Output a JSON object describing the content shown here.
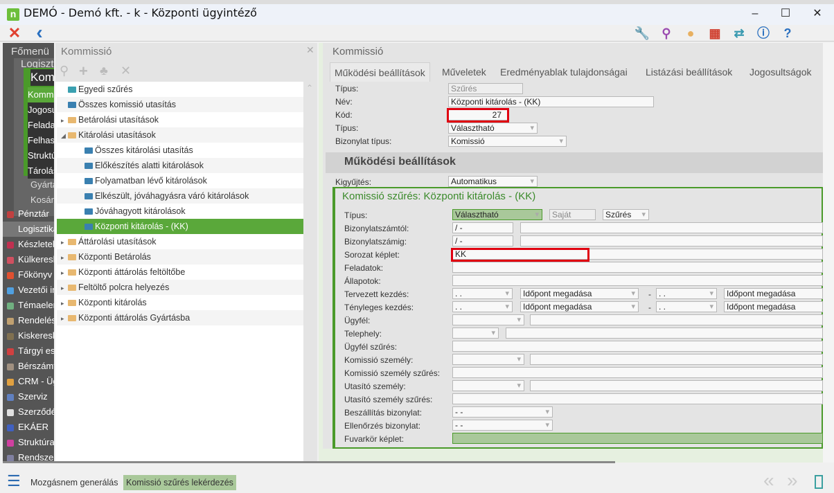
{
  "window": {
    "title": "DEMÓ - Demó kft. - k - Központi ügyintéző",
    "logo": "n",
    "minimize": "–",
    "maximize": "☐",
    "close": "✕"
  },
  "toolbar": {
    "close_icon": "✕",
    "back_icon": "‹",
    "right_icons": [
      {
        "name": "wrench-icon",
        "glyph": "🔧",
        "color": "#4aaa7a"
      },
      {
        "name": "search-icon",
        "glyph": "⚲",
        "color": "#9a4ab0"
      },
      {
        "name": "user-icon",
        "glyph": "●",
        "color": "#e8b060"
      },
      {
        "name": "modules-icon",
        "glyph": "▦",
        "color": "#d04030"
      },
      {
        "name": "swap-icon",
        "glyph": "⇄",
        "color": "#3a9ab0"
      },
      {
        "name": "info-icon",
        "glyph": "ⓘ",
        "color": "#2a70c0"
      },
      {
        "name": "help-icon",
        "glyph": "?",
        "color": "#2a70c0"
      }
    ]
  },
  "leftmenu": {
    "header": "Főmenü",
    "sub": "Logisztika",
    "active_group": "Kommissió",
    "group_items": [
      "Kommissió",
      "Jogosultságok",
      "Feladatok",
      "Felhasználók",
      "Struktúra",
      "Tárolás"
    ],
    "sub_items": [
      "Gyártás",
      "Kosár"
    ],
    "items": [
      {
        "label": "Pénztár",
        "color": "#c04040"
      },
      {
        "label": "Logisztika",
        "color": ""
      },
      {
        "label": "Készletek",
        "color": "#c03050"
      },
      {
        "label": "Külkereskedelem",
        "color": "#d05060"
      },
      {
        "label": "Főkönyv",
        "color": "#e05030"
      },
      {
        "label": "Vezetői info",
        "color": "#50a0e0"
      },
      {
        "label": "Témaelemzés",
        "color": "#70b080"
      },
      {
        "label": "Rendelések",
        "color": "#c0a070"
      },
      {
        "label": "Kiskereskedelem",
        "color": "#807050"
      },
      {
        "label": "Tárgyi eszköz",
        "color": "#d04040"
      },
      {
        "label": "Bérszámfejtés",
        "color": "#a09080"
      },
      {
        "label": "CRM - Ügyfél",
        "color": "#e0a040"
      },
      {
        "label": "Szerviz",
        "color": "#6080c0"
      },
      {
        "label": "Szerződések",
        "color": "#e0e0e0"
      },
      {
        "label": "EKÁER",
        "color": "#4060c0"
      },
      {
        "label": "Struktúra",
        "color": "#d040a0"
      },
      {
        "label": "Rendszer",
        "color": "#8080a0"
      }
    ]
  },
  "tree": {
    "title": "Kommissió",
    "items": [
      {
        "label": "Egyedi szűrés",
        "level": 0,
        "icon": "filter",
        "exp": ""
      },
      {
        "label": "Összes komissió utasítás",
        "level": 0,
        "icon": "printer",
        "exp": ""
      },
      {
        "label": "Betárolási utasítások",
        "level": 0,
        "icon": "folder",
        "exp": "▸"
      },
      {
        "label": "Kitárolási utasítások",
        "level": 0,
        "icon": "folder",
        "exp": "◢"
      },
      {
        "label": "Összes kitárolási utasítás",
        "level": 1,
        "icon": "screen",
        "exp": ""
      },
      {
        "label": "Előkészítés alatti kitárolások",
        "level": 1,
        "icon": "screen",
        "exp": ""
      },
      {
        "label": "Folyamatban lévő kitárolások",
        "level": 1,
        "icon": "screen",
        "exp": ""
      },
      {
        "label": "Elkészült, jóváhagyásra váró kitárolások",
        "level": 1,
        "icon": "screen",
        "exp": ""
      },
      {
        "label": "Jóváhagyott kitárolások",
        "level": 1,
        "icon": "screen",
        "exp": ""
      },
      {
        "label": "Központi kitárolás - (KK)",
        "level": 1,
        "icon": "printer",
        "exp": "",
        "selected": true
      },
      {
        "label": "Áttárolási utasítások",
        "level": 0,
        "icon": "folder",
        "exp": "▸"
      },
      {
        "label": "Központi Betárolás",
        "level": 0,
        "icon": "folder",
        "exp": "▸"
      },
      {
        "label": "Központi áttárolás feltöltőbe",
        "level": 0,
        "icon": "folder",
        "exp": "▸"
      },
      {
        "label": "Feltöltő polcra helyezés",
        "level": 0,
        "icon": "folder",
        "exp": "▸"
      },
      {
        "label": "Központi kitárolás",
        "level": 0,
        "icon": "folder",
        "exp": "▸"
      },
      {
        "label": "Központi áttárolás Gyártásba",
        "level": 0,
        "icon": "folder",
        "exp": "▸"
      }
    ]
  },
  "main": {
    "title": "Kommissió",
    "tabs": [
      "Működési beállítások",
      "Műveletek",
      "Eredményablak tulajdonságai",
      "Listázási beállítások",
      "Jogosultságok"
    ],
    "top_fields": [
      {
        "label": "Típus:",
        "value": "Szűrés"
      },
      {
        "label": "Név:",
        "value": "Központi kitárolás - (KK)"
      },
      {
        "label": "Kód:",
        "value": "27"
      },
      {
        "label": "Típus:",
        "value": "Választható"
      },
      {
        "label": "Bizonylat típus:",
        "value": "Komissió"
      }
    ],
    "section_title": "Működési beállítások",
    "kigyujtes": {
      "label": "Kigyűjtés:",
      "value": "Automatikus"
    },
    "filter_box": {
      "title": "Komissió szűrés: Központi kitárolás - (KK)",
      "rows": [
        {
          "label": "Típus:",
          "values": [
            "Választható",
            "Saját",
            "Szűrés"
          ]
        },
        {
          "label": "Bizonylatszámtól:",
          "values": [
            "/ -",
            ""
          ]
        },
        {
          "label": "Bizonylatszámig:",
          "values": [
            "/ -",
            ""
          ]
        },
        {
          "label": "Sorozat képlet:",
          "values": [
            "KK"
          ]
        },
        {
          "label": "Feladatok:",
          "values": [
            ""
          ]
        },
        {
          "label": "Állapotok:",
          "values": [
            ""
          ]
        },
        {
          "label": "Tervezett kezdés:",
          "values": [
            ". .",
            "Időpont megadása",
            "-",
            ". .",
            "Időpont megadása"
          ]
        },
        {
          "label": "Tényleges kezdés:",
          "values": [
            ". .",
            "Időpont megadása",
            "-",
            ". .",
            "Időpont megadása"
          ]
        },
        {
          "label": "Ügyfél:",
          "values": [
            "",
            ""
          ]
        },
        {
          "label": "Telephely:",
          "values": [
            "",
            ""
          ]
        },
        {
          "label": "Ügyfél szűrés:",
          "values": [
            ""
          ]
        },
        {
          "label": "Komissió személy:",
          "values": [
            "",
            ""
          ]
        },
        {
          "label": "Komissió személy szűrés:",
          "values": [
            ""
          ]
        },
        {
          "label": "Utasító személy:",
          "values": [
            "",
            ""
          ]
        },
        {
          "label": "Utasító személy szűrés:",
          "values": [
            ""
          ]
        },
        {
          "label": "Beszállítás bizonylat:",
          "values": [
            "-  -"
          ]
        },
        {
          "label": "Ellenőrzés bizonylat:",
          "values": [
            "-  -"
          ]
        },
        {
          "label": "Fuvarkör képlet:",
          "values": [
            ""
          ]
        }
      ]
    }
  },
  "bottombar": {
    "menu_icon": "☰",
    "buttons": [
      "Mozgásnem generálás",
      "Komissió szűrés lekérdezés"
    ],
    "prev": "«",
    "next": "»"
  },
  "colors": {
    "accent": "#5aa83a",
    "highlight": "#e00010"
  }
}
